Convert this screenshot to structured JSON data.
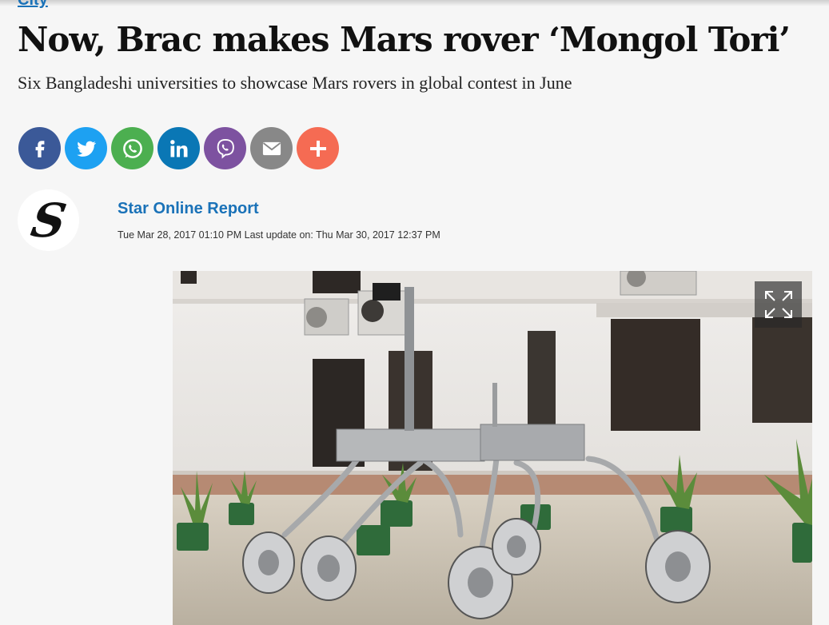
{
  "section": {
    "label": "City"
  },
  "article": {
    "headline": "Now, Brac makes Mars rover ‘Mongol Tori’",
    "subheadline": "Six Bangladeshi universities to showcase Mars rovers in global contest in June"
  },
  "share_buttons": [
    {
      "name": "facebook",
      "icon": "facebook-icon",
      "color": "#3b5998"
    },
    {
      "name": "twitter",
      "icon": "twitter-icon",
      "color": "#1da1f2"
    },
    {
      "name": "whatsapp",
      "icon": "whatsapp-icon",
      "color": "#4caf50"
    },
    {
      "name": "linkedin",
      "icon": "linkedin-icon",
      "color": "#0a77b5"
    },
    {
      "name": "viber",
      "icon": "viber-icon",
      "color": "#7d52a0"
    },
    {
      "name": "email",
      "icon": "email-icon",
      "color": "#888888"
    },
    {
      "name": "more",
      "icon": "plus-icon",
      "color": "#f56b53"
    }
  ],
  "author": {
    "logo_letter": "S",
    "name": "Star Online Report",
    "dateline": "Tue Mar 28, 2017 01:10 PM Last update on: Thu Mar 30, 2017 12:37 PM"
  },
  "image": {
    "description_icon": "expand-icon"
  },
  "colors": {
    "link_blue": "#1a72b8",
    "background": "#f6f6f6"
  }
}
